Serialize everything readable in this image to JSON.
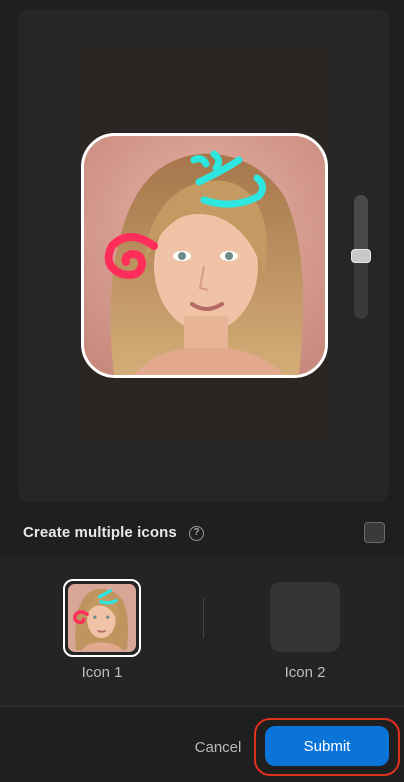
{
  "multi_icons": {
    "label": "Create multiple icons",
    "help_glyph": "?",
    "checked": false
  },
  "zoom": {
    "level": 0.5
  },
  "icons": [
    {
      "label": "Icon 1",
      "selected": true
    },
    {
      "label": "Icon 2",
      "selected": false
    }
  ],
  "footer": {
    "cancel_label": "Cancel",
    "submit_label": "Submit"
  },
  "colors": {
    "accent": "#0a74d9",
    "highlight_ring": "#e0301e",
    "doodle_cyan": "#2ee6e0",
    "doodle_pink": "#ff2d5a"
  }
}
